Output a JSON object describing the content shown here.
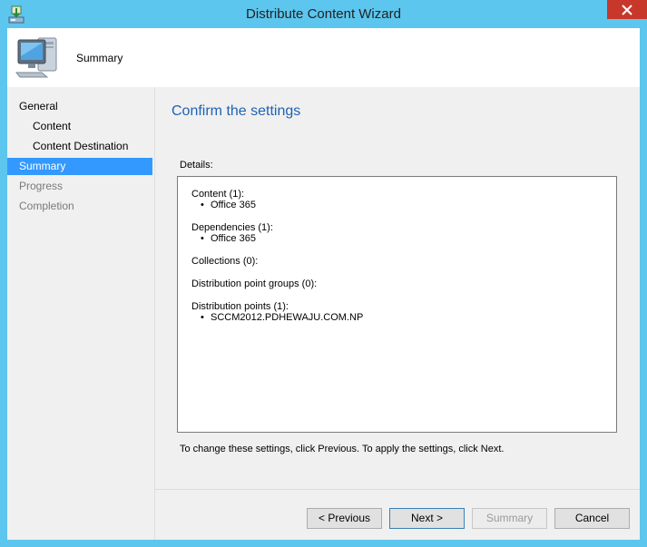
{
  "window": {
    "title": "Distribute Content Wizard"
  },
  "header": {
    "title": "Summary"
  },
  "nav": {
    "items": [
      {
        "label": "General"
      },
      {
        "label": "Content"
      },
      {
        "label": "Content Destination"
      },
      {
        "label": "Summary"
      },
      {
        "label": "Progress"
      },
      {
        "label": "Completion"
      }
    ]
  },
  "main": {
    "heading": "Confirm the settings",
    "details_label": "Details:",
    "sections": [
      {
        "title": "Content (1):",
        "items": [
          "Office 365"
        ]
      },
      {
        "title": "Dependencies (1):",
        "items": [
          "Office 365"
        ]
      },
      {
        "title": "Collections (0):",
        "items": []
      },
      {
        "title": "Distribution point groups (0):",
        "items": []
      },
      {
        "title": "Distribution points (1):",
        "items": [
          "SCCM2012.PDHEWAJU.COM.NP"
        ]
      }
    ],
    "footnote": "To change these settings, click Previous. To apply the settings, click Next."
  },
  "buttons": {
    "previous": "< Previous",
    "next": "Next >",
    "summary": "Summary",
    "cancel": "Cancel"
  },
  "colors": {
    "frame": "#5cc6ee",
    "close": "#c7382b",
    "selection": "#3399ff",
    "heading": "#1e62b4"
  }
}
